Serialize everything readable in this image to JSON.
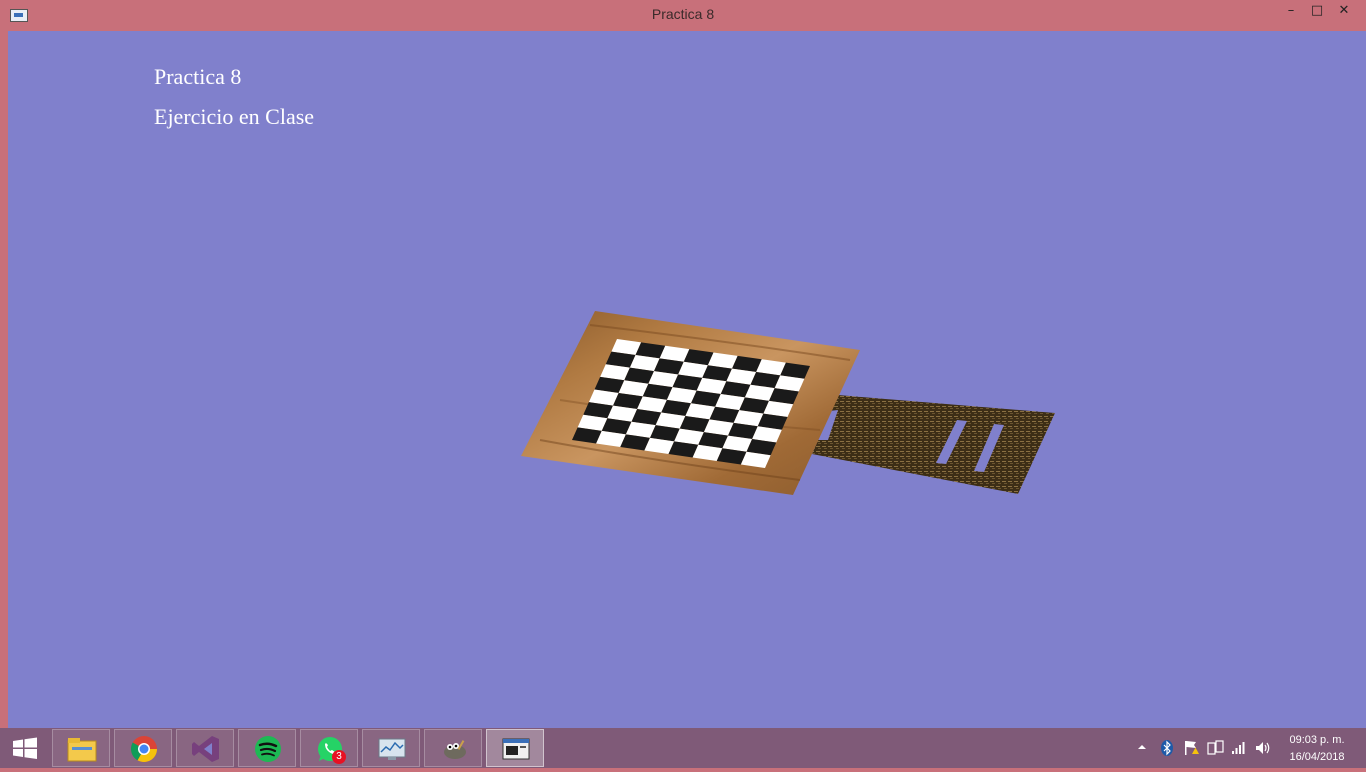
{
  "window": {
    "title": "Practica 8",
    "controls": {
      "minimize": "–",
      "maximize": "□",
      "close": "✕"
    },
    "background_color": "#8080cc",
    "frame_color": "#c8707a"
  },
  "overlay_text": {
    "line1": "Practica 8",
    "line2": "Ejercicio en Clase"
  },
  "scene": {
    "board_squares": 8,
    "board_texture": "wood",
    "handle_texture": "dark-wood"
  },
  "taskbar": {
    "apps": [
      {
        "name": "File Explorer",
        "icon": "folder-icon"
      },
      {
        "name": "Google Chrome",
        "icon": "chrome-icon"
      },
      {
        "name": "Visual Studio",
        "icon": "visual-studio-icon"
      },
      {
        "name": "Spotify",
        "icon": "spotify-icon"
      },
      {
        "name": "WhatsApp",
        "icon": "whatsapp-icon",
        "badge": "3"
      },
      {
        "name": "Resource Monitor",
        "icon": "monitor-icon"
      },
      {
        "name": "GIMP",
        "icon": "gimp-icon"
      },
      {
        "name": "Practica 8",
        "icon": "opengl-window-icon",
        "active": true
      }
    ],
    "tray": [
      "show-hidden-icon",
      "bluetooth-icon",
      "action-center-flag-icon",
      "network-icon",
      "signal-icon",
      "volume-icon"
    ],
    "clock": {
      "time": "09:03 p. m.",
      "date": "16/04/2018"
    }
  }
}
